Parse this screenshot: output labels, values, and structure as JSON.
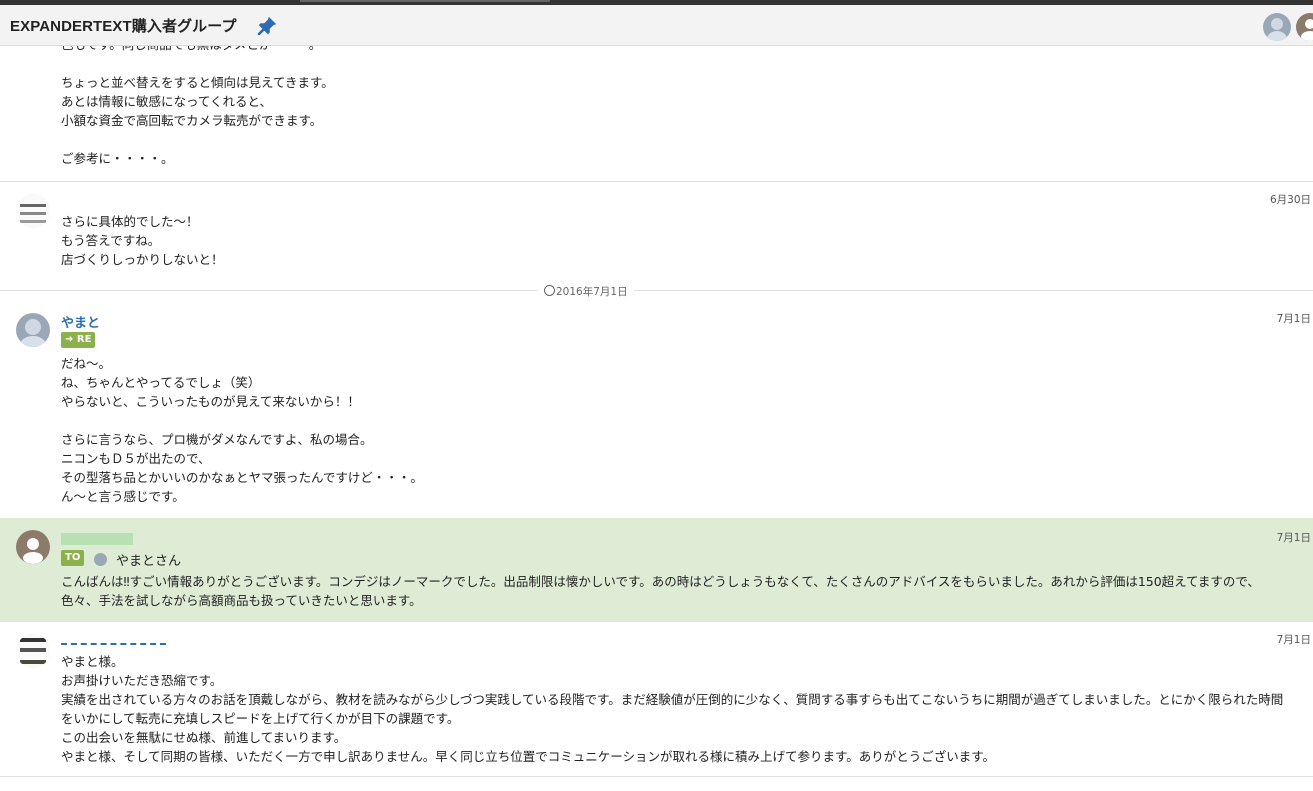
{
  "header": {
    "title": "EXPANDERTEXT購入者グループ"
  },
  "messages": [
    {
      "body": "色もです。同じ商品でも黒はダメとか・・・。\n\nちょっと並べ替えをすると傾向は見えてきます。\nあとは情報に敏感になってくれると、\n小額な資金で高回転でカメラ転売ができます。\n\nご参考に・・・・。"
    },
    {
      "name": "",
      "date": "6月30日",
      "body": "さらに具体的でした～！\nもう答えですね。\n店づくりしっかりしないと！"
    },
    {
      "name": "やまと",
      "date": "7月1日",
      "badge": "RE",
      "body": "だね～。\nね、ちゃんとやってるでしょ（笑）\nやらないと、こういったものが見えて来ないから！！\n\nさらに言うなら、プロ機がダメなんですよ、私の場合。\nニコンもＤ５が出たので、\nその型落ち品とかいいのかなぁとヤマ張ったんですけど・・・。\nん～と言う感じです。"
    },
    {
      "date": "7月1日",
      "badge": "TO",
      "to_name": "やまとさん",
      "body": "こんばんは‼すごい情報ありがとうございます。コンデジはノーマークでした。出品制限は懐かしいです。あの時はどうしょうもなくて、たくさんのアドバイスをもらいました。あれから評価は150超えてますので、色々、手法を試しながら高額商品も扱っていきたいと思います。"
    },
    {
      "date": "7月1日",
      "body": "やまと様。\nお声掛けいただき恐縮です。\n実績を出されている方々のお話を頂戴しながら、教材を読みながら少しづつ実践している段階です。まだ経験値が圧倒的に少なく、質問する事すらも出てこないうちに期間が過ぎてしまいました。とにかく限られた時間をいかにして転売に充填しスピードを上げて行くかが目下の課題です。\nこの出会いを無駄にせぬ様、前進してまいります。\nやまと様、そして同期の皆様、いただく一方で申し訳ありません。早く同じ立ち位置でコミュニケーションが取れる様に積み上げて参ります。ありがとうございます。"
    }
  ],
  "day_separator": "2016年7月1日",
  "colors": {
    "highlight": "#deecd6",
    "badge": "#8cb04c",
    "name": "#2a6fb0"
  }
}
